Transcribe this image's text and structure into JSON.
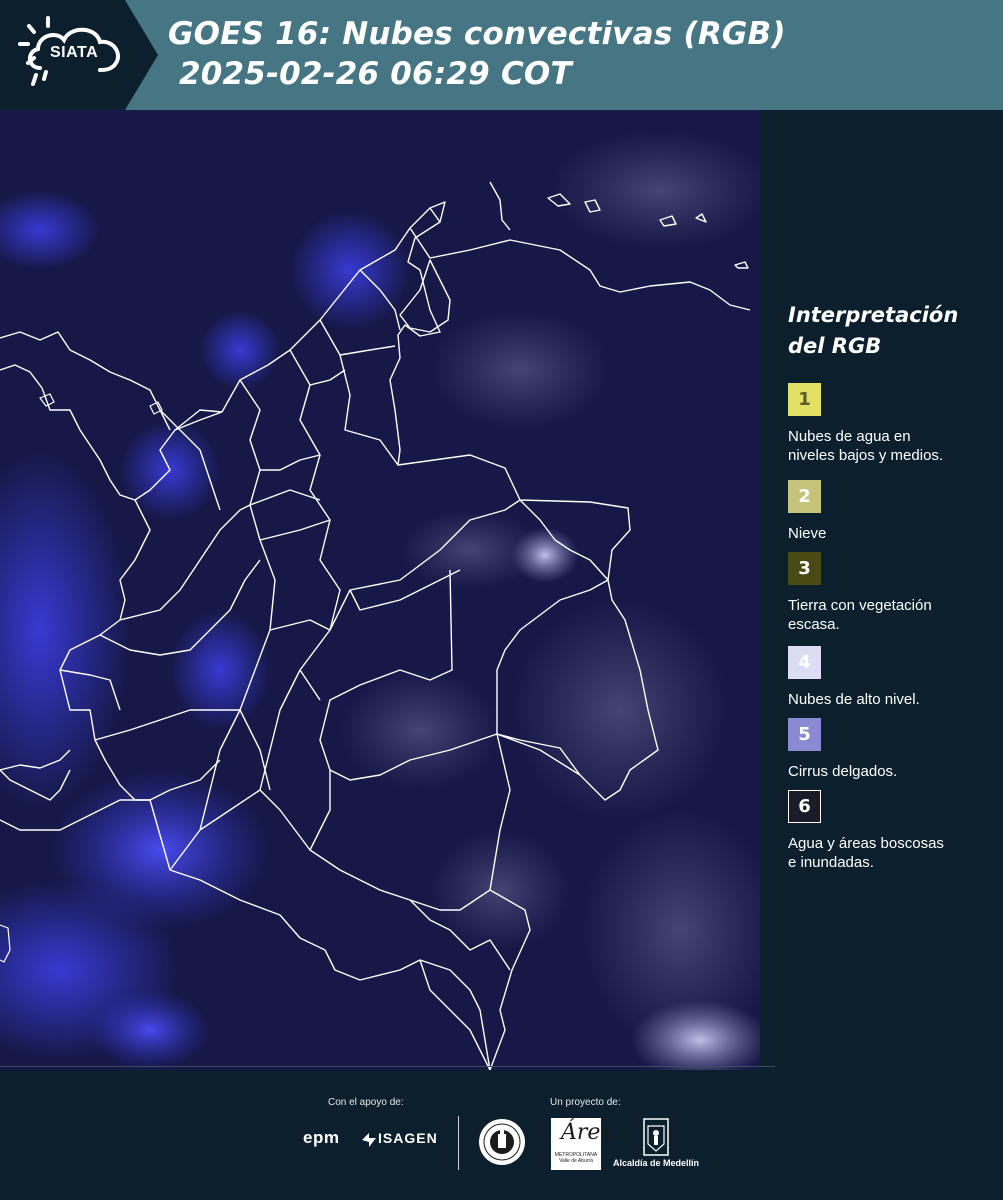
{
  "header": {
    "logo_text": "SIATA",
    "title_line1": "GOES 16: Nubes convectivas (RGB)",
    "title_line2": " 2025-02-26 06:29 COT",
    "background_color": "#467684"
  },
  "map": {
    "description_icon": "satellite-map",
    "background_color": "#141546",
    "border_color": "#ffffff"
  },
  "legend": {
    "title_line1": "Interpretación",
    "title_line2": "del RGB",
    "items": [
      {
        "number": "1",
        "label": "Nubes de agua en\nniveles bajos y medios.",
        "color": "#e2e166",
        "text_color": "#5a5a2a"
      },
      {
        "number": "2",
        "label": "Nieve",
        "color": "#c4c47a",
        "text_color": "#ffffff"
      },
      {
        "number": "3",
        "label": "Tierra con vegetación\nescasa.",
        "color": "#4a4a14",
        "text_color": "#ffffff"
      },
      {
        "number": "4",
        "label": "Nubes de alto nivel.",
        "color": "#dcdcf4",
        "text_color": "#ffffff"
      },
      {
        "number": "5",
        "label": "Cirrus delgados.",
        "color": "#8a8ad2",
        "text_color": "#ffffff"
      },
      {
        "number": "6",
        "label": "Agua y áreas boscosas\ne inundadas.",
        "color": "#1b1b2a",
        "text_color": "#ffffff"
      }
    ]
  },
  "footer": {
    "support_label": "Con el apoyo de:",
    "project_label": "Un proyecto de:",
    "sponsor1": "epm",
    "sponsor2": "ISAGEN",
    "partner1_script": "Área",
    "partner1_sub": "METROPOLITANA\nValle de Aburrá",
    "partner2": "Alcaldía de Medellín"
  }
}
